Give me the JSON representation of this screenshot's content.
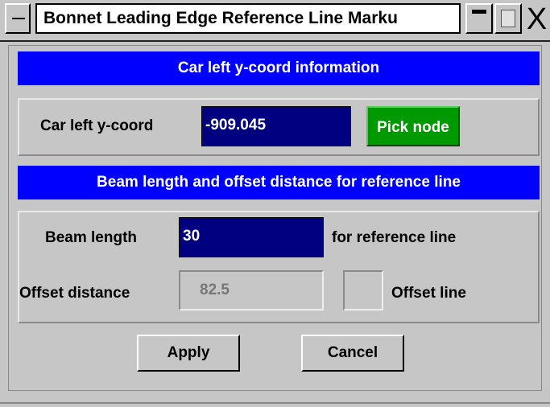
{
  "window": {
    "title": "Bonnet Leading Edge Reference Line Marku",
    "close_glyph": "X"
  },
  "section_car": {
    "header": "Car left y-coord information",
    "label": "Car left y-coord",
    "value": "-909.045",
    "pick_label": "Pick node"
  },
  "section_beam": {
    "header": "Beam length and offset distance for reference line",
    "beam_label": "Beam length",
    "beam_value": "30",
    "beam_suffix": "for reference line",
    "offset_label": "Offset distance",
    "offset_value": "82.5",
    "offset_line_label": "Offset line",
    "offset_line_checked": false
  },
  "buttons": {
    "apply": "Apply",
    "cancel": "Cancel"
  },
  "colors": {
    "header_bg": "#0000ff",
    "field_bg": "#000080",
    "pick_bg": "#009900",
    "dialog_bg": "#c6c6c6"
  }
}
